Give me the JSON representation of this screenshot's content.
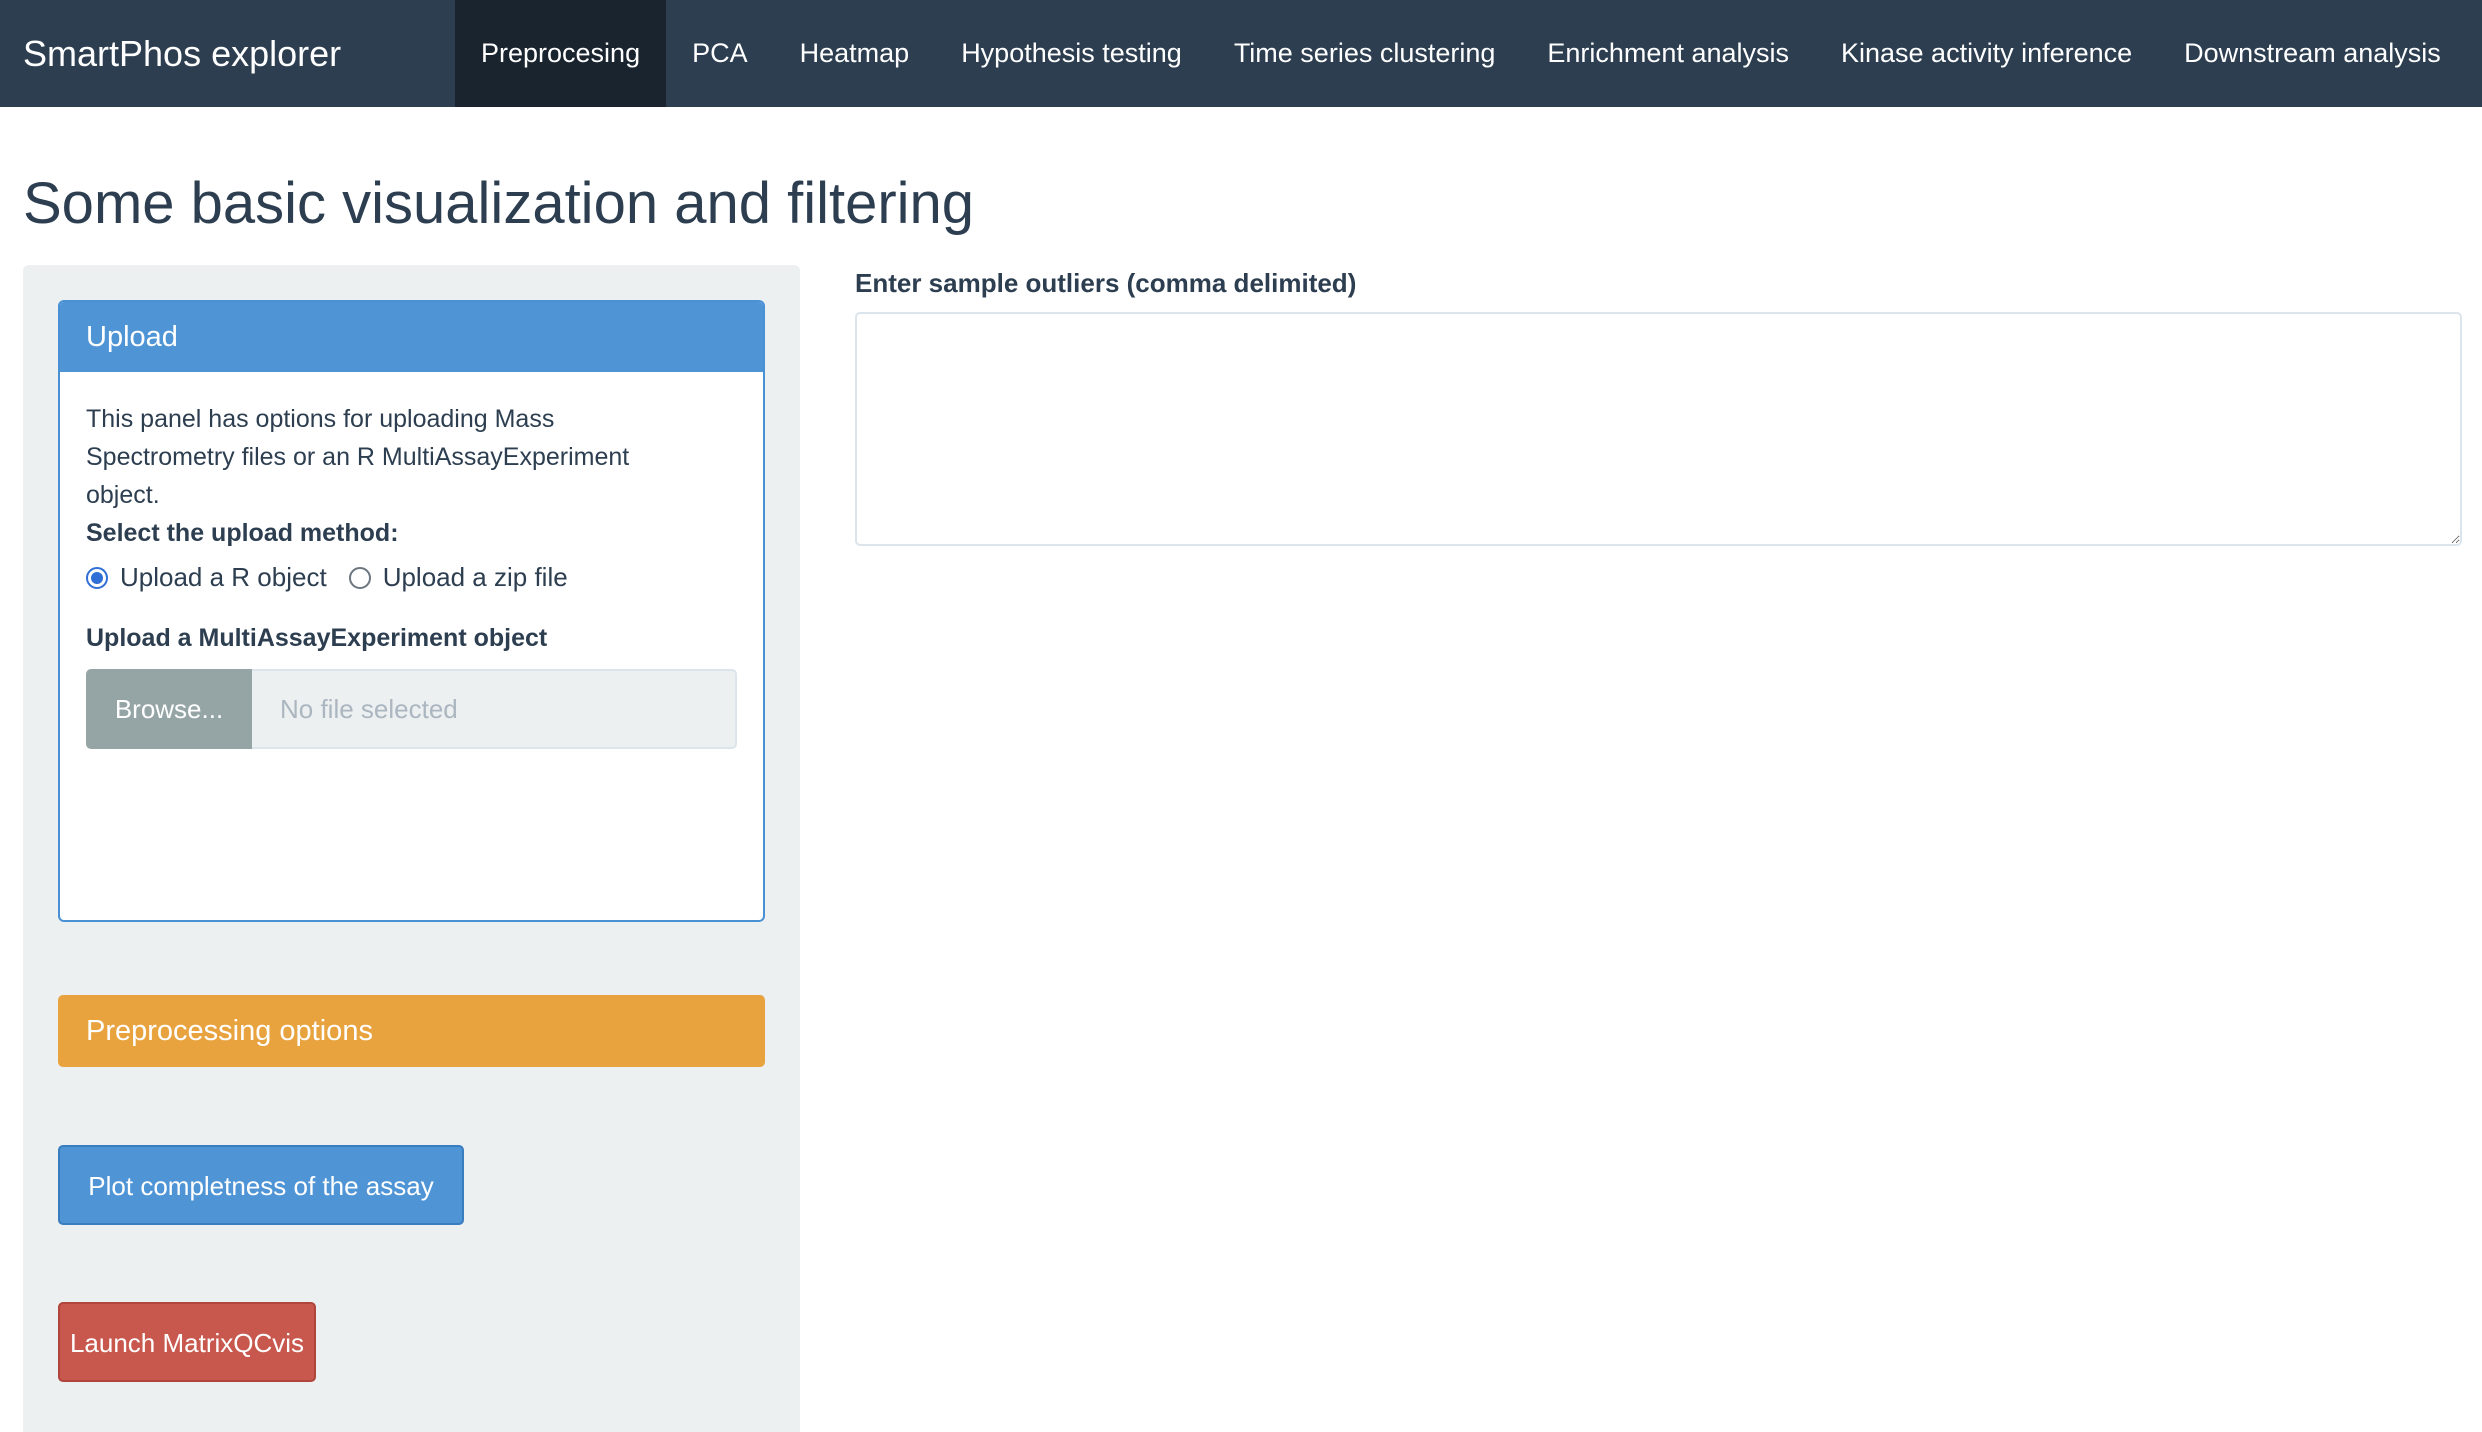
{
  "app": {
    "brand": "SmartPhos explorer"
  },
  "nav": {
    "tabs": [
      {
        "label": "Preprocesing",
        "active": true
      },
      {
        "label": "PCA",
        "active": false
      },
      {
        "label": "Heatmap",
        "active": false
      },
      {
        "label": "Hypothesis testing",
        "active": false
      },
      {
        "label": "Time series clustering",
        "active": false
      },
      {
        "label": "Enrichment analysis",
        "active": false
      },
      {
        "label": "Kinase activity inference",
        "active": false
      },
      {
        "label": "Downstream analysis",
        "active": false
      }
    ]
  },
  "page": {
    "title": "Some basic visualization and filtering"
  },
  "upload_panel": {
    "heading": "Upload",
    "description": "This panel has options for uploading Mass Spectrometry files or an R MultiAssayExperiment object.",
    "method_label": "Select the upload method:",
    "options": [
      {
        "label": "Upload a R object",
        "checked": true
      },
      {
        "label": "Upload a zip file",
        "checked": false
      }
    ],
    "file_label": "Upload a MultiAssayExperiment object",
    "browse_label": "Browse...",
    "file_placeholder": "No file selected"
  },
  "preprocessing_panel": {
    "heading": "Preprocessing options"
  },
  "buttons": {
    "plot_completeness": "Plot completness of the assay",
    "launch_matrixqc": "Launch MatrixQCvis"
  },
  "outliers": {
    "label": "Enter sample outliers (comma delimited)",
    "value": ""
  },
  "colors": {
    "navbar": "#2c3e50",
    "active_tab": "#1a242f",
    "primary": "#4f95d6",
    "warning": "#e8a33f",
    "danger": "#c8584d",
    "well": "#ecf0f1"
  }
}
